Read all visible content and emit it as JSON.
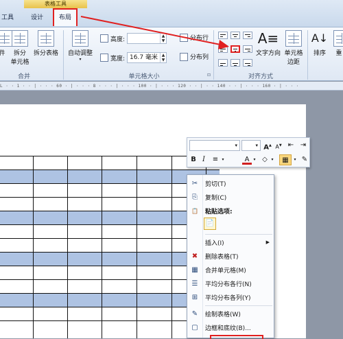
{
  "ribbon": {
    "context_title": "表格工具",
    "tabs": [
      {
        "label": "工具"
      },
      {
        "label": "设计"
      },
      {
        "label": "布局"
      }
    ],
    "merge_group": {
      "label": "合并",
      "buttons": [
        "件",
        "拆分\n单元格",
        "拆分表格"
      ]
    },
    "cellsize_group": {
      "label": "单元格大小",
      "autofit_label": "自动调整",
      "height_label": "高度:",
      "height_value": "",
      "width_label": "宽度:",
      "width_value": "16.7 毫米",
      "distribute_rows": "分布行",
      "distribute_cols": "分布列"
    },
    "align_group": {
      "label": "对齐方式",
      "text_direction": "文字方向",
      "cell_margins": "单元格\n边距"
    },
    "sort_label": "排序",
    "overflow_label": "重"
  },
  "ruler_text": "L · · 1 · · | · · · 60 · | · · · 8 · · · | · · · 100 · | · · · 120 · · | · · 140 · · | · · · 160 · | · · ·",
  "mini_toolbar": {
    "font_value": "",
    "size_value": ""
  },
  "context_menu": {
    "items": [
      {
        "icon": "✂",
        "label": "剪切(T)"
      },
      {
        "icon": "⎘",
        "label": "复制(C)"
      },
      {
        "icon": "📋",
        "label": "粘贴选项:"
      },
      {
        "icon": "",
        "label": "插入(I)"
      },
      {
        "icon": "✖",
        "label": "删除表格(T)"
      },
      {
        "icon": "▦",
        "label": "合并单元格(M)"
      },
      {
        "icon": "☰",
        "label": "平均分布各行(N)"
      },
      {
        "icon": "⊞",
        "label": "平均分布各列(Y)"
      },
      {
        "icon": "✎",
        "label": "绘制表格(W)"
      },
      {
        "icon": "▢",
        "label": "边框和底纹(B)..."
      }
    ]
  },
  "colors": {
    "highlight_red": "#e02020",
    "table_shade": "#aec3e3"
  }
}
